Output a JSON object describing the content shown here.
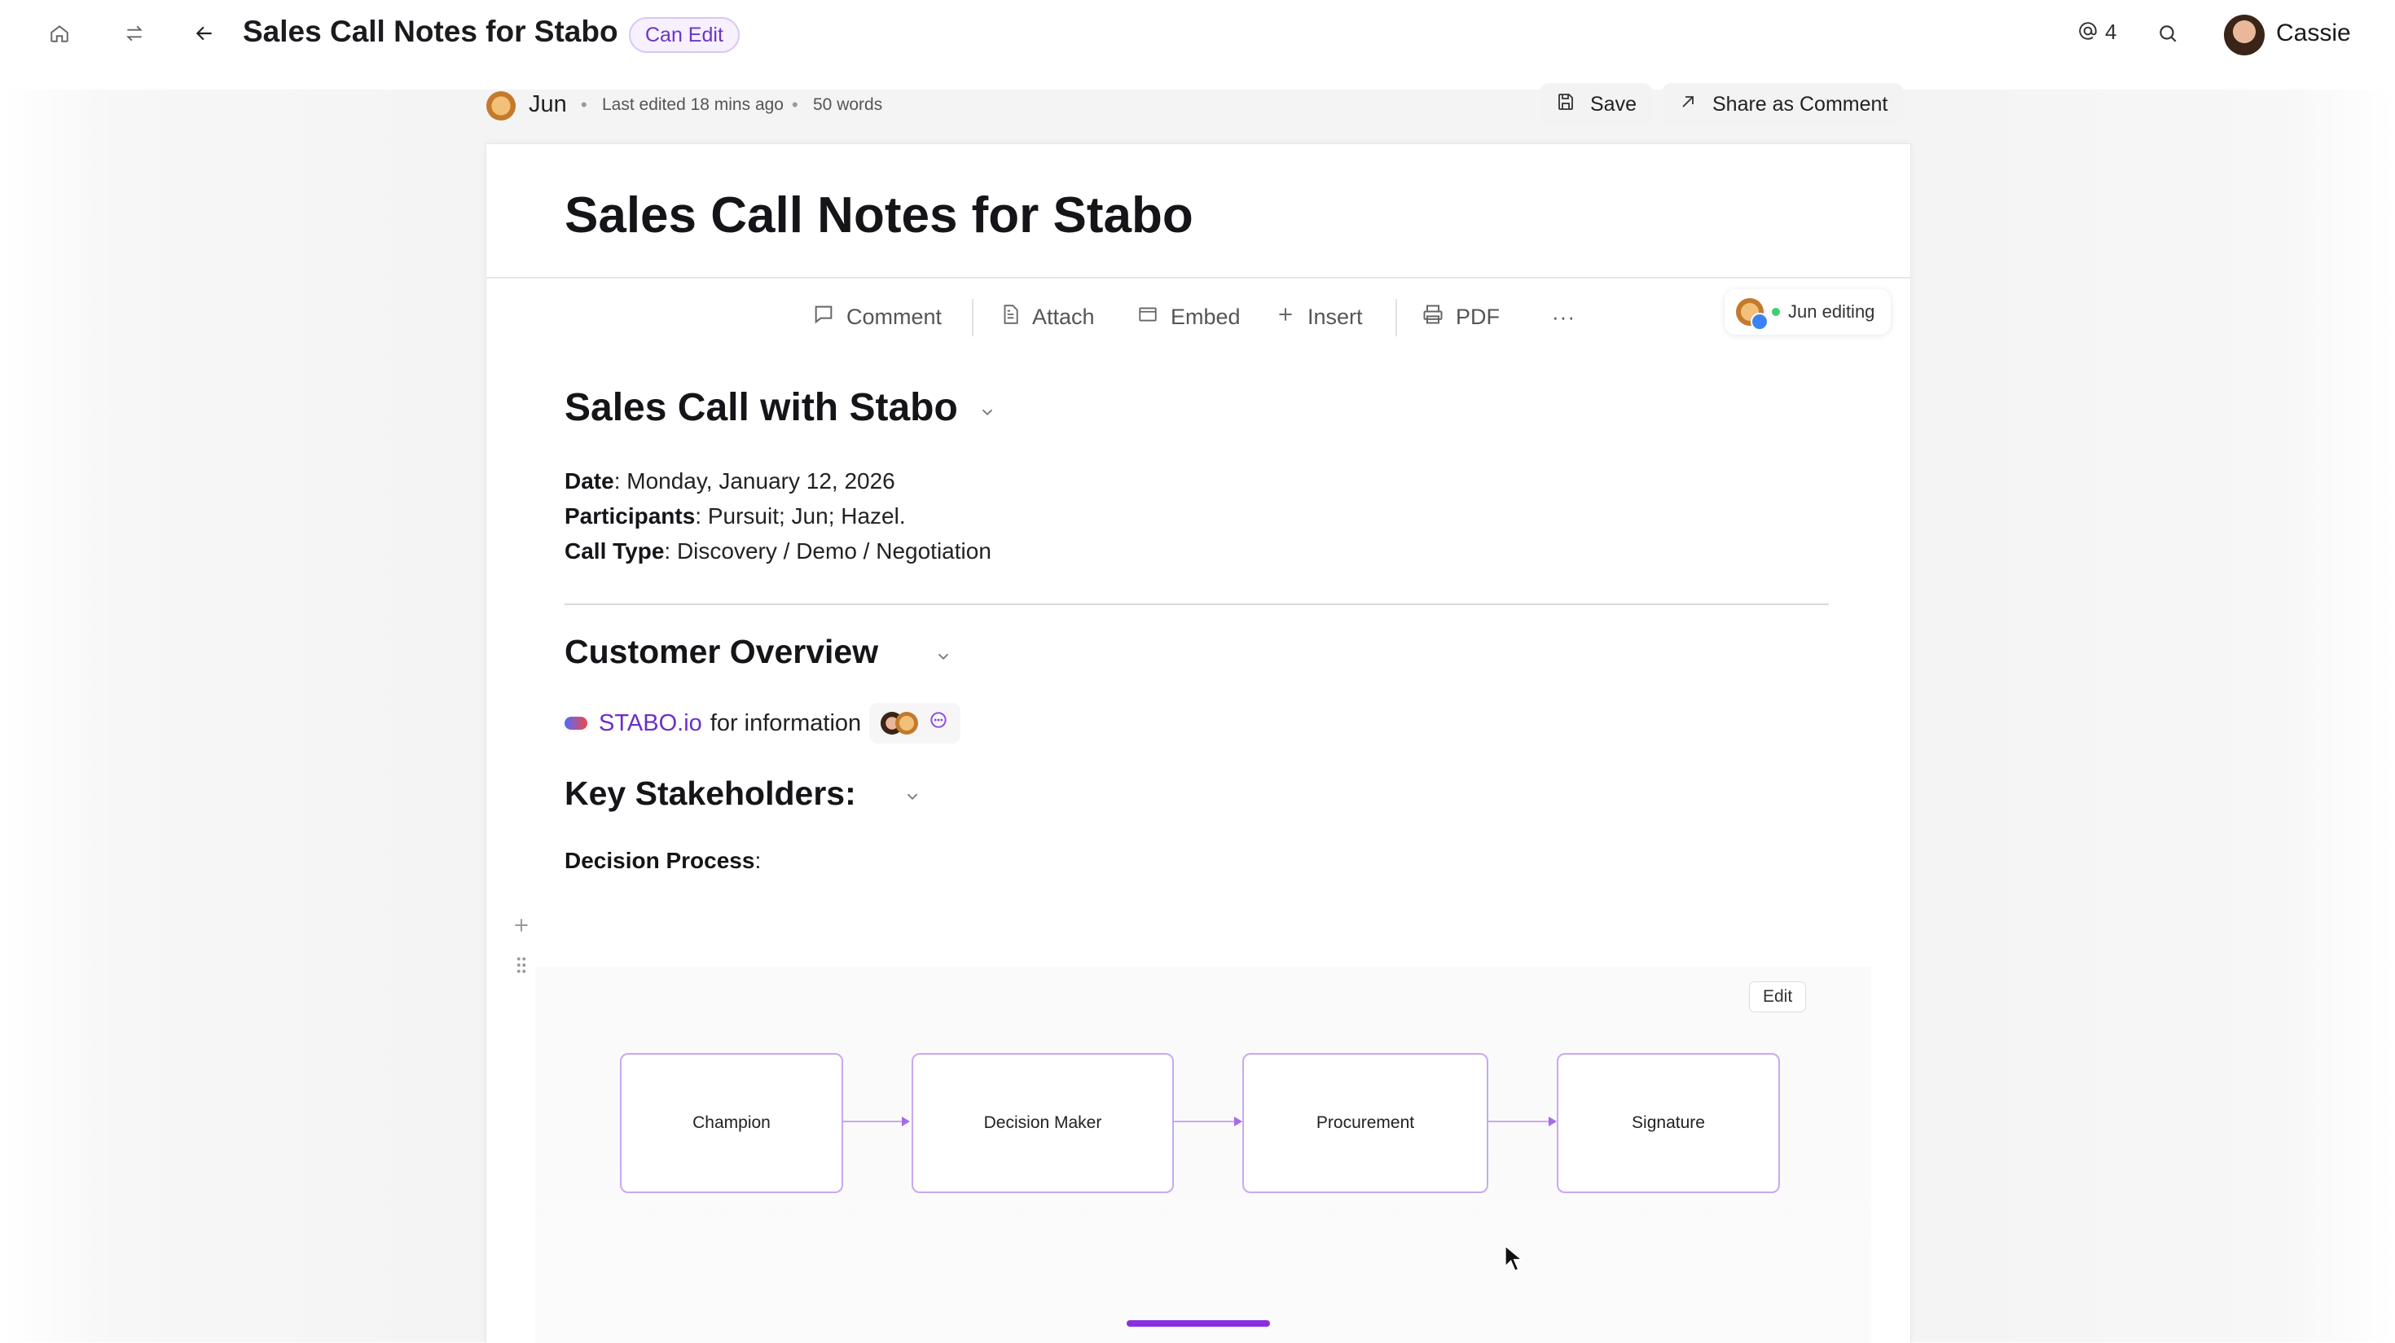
{
  "topbar": {
    "title": "Sales Call Notes for Stabo",
    "permission_badge": "Can Edit",
    "mentions_count": "4",
    "user_name": "Cassie"
  },
  "meta": {
    "author": "Jun",
    "last_edited": "Last edited 18 mins ago",
    "word_count": "50 words",
    "save_label": "Save",
    "share_label": "Share as Comment"
  },
  "doc": {
    "title": "Sales Call Notes for Stabo",
    "toolbar": {
      "comment": "Comment",
      "attach": "Attach",
      "embed": "Embed",
      "insert": "Insert",
      "pdf": "PDF",
      "more": "···",
      "editing": "Jun editing"
    },
    "section1": {
      "heading": "Sales Call with Stabo",
      "date_label": "Date",
      "date_value": ": Monday, January 12, 2026",
      "participants_label": "Participants",
      "participants_value": ": Pursuit; Jun; Hazel.",
      "call_type_label": "Call Type",
      "call_type_value": ": Discovery / Demo / Negotiation"
    },
    "section2": {
      "heading": "Customer Overview",
      "link_text": "STABO.io",
      "link_suffix": "for information"
    },
    "section3": {
      "heading": "Key Stakeholders:",
      "decision_label": "Decision Process",
      "decision_suffix": ":"
    },
    "diagram": {
      "edit_label": "Edit",
      "nodes": [
        "Champion",
        "Decision Maker",
        "Procurement",
        "Signature"
      ]
    }
  },
  "colors": {
    "accent": "#6b2fc9",
    "node_border": "#c9a8f2",
    "badge_bg": "#f6f0ff"
  }
}
